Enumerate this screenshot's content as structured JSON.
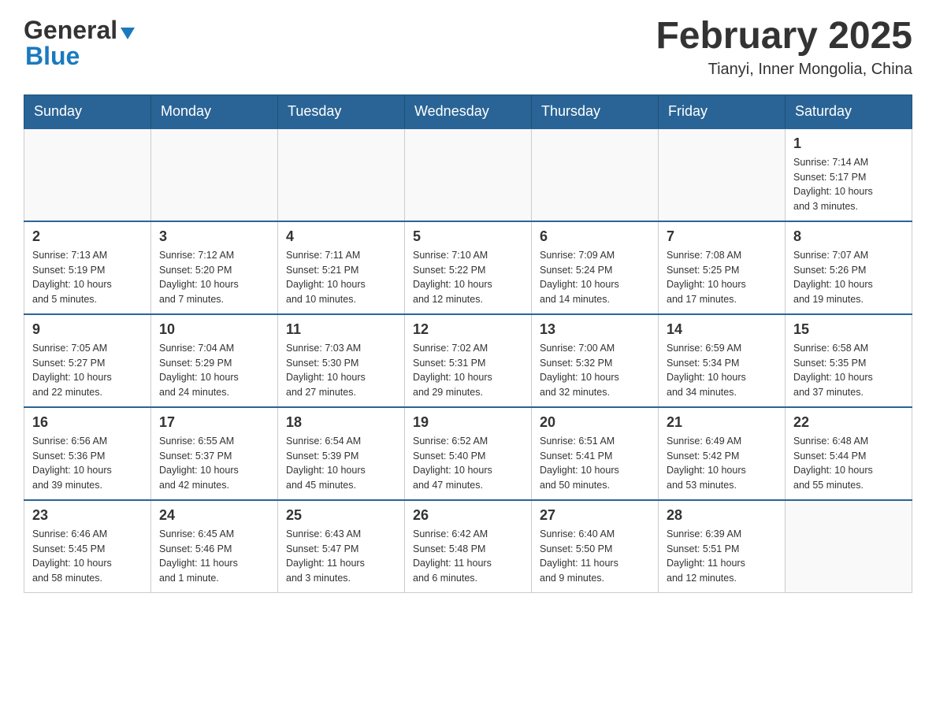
{
  "header": {
    "logo_general": "General",
    "logo_blue": "Blue",
    "month_title": "February 2025",
    "location": "Tianyi, Inner Mongolia, China"
  },
  "days_of_week": [
    "Sunday",
    "Monday",
    "Tuesday",
    "Wednesday",
    "Thursday",
    "Friday",
    "Saturday"
  ],
  "weeks": [
    {
      "days": [
        {
          "date": "",
          "info": ""
        },
        {
          "date": "",
          "info": ""
        },
        {
          "date": "",
          "info": ""
        },
        {
          "date": "",
          "info": ""
        },
        {
          "date": "",
          "info": ""
        },
        {
          "date": "",
          "info": ""
        },
        {
          "date": "1",
          "info": "Sunrise: 7:14 AM\nSunset: 5:17 PM\nDaylight: 10 hours\nand 3 minutes."
        }
      ]
    },
    {
      "days": [
        {
          "date": "2",
          "info": "Sunrise: 7:13 AM\nSunset: 5:19 PM\nDaylight: 10 hours\nand 5 minutes."
        },
        {
          "date": "3",
          "info": "Sunrise: 7:12 AM\nSunset: 5:20 PM\nDaylight: 10 hours\nand 7 minutes."
        },
        {
          "date": "4",
          "info": "Sunrise: 7:11 AM\nSunset: 5:21 PM\nDaylight: 10 hours\nand 10 minutes."
        },
        {
          "date": "5",
          "info": "Sunrise: 7:10 AM\nSunset: 5:22 PM\nDaylight: 10 hours\nand 12 minutes."
        },
        {
          "date": "6",
          "info": "Sunrise: 7:09 AM\nSunset: 5:24 PM\nDaylight: 10 hours\nand 14 minutes."
        },
        {
          "date": "7",
          "info": "Sunrise: 7:08 AM\nSunset: 5:25 PM\nDaylight: 10 hours\nand 17 minutes."
        },
        {
          "date": "8",
          "info": "Sunrise: 7:07 AM\nSunset: 5:26 PM\nDaylight: 10 hours\nand 19 minutes."
        }
      ]
    },
    {
      "days": [
        {
          "date": "9",
          "info": "Sunrise: 7:05 AM\nSunset: 5:27 PM\nDaylight: 10 hours\nand 22 minutes."
        },
        {
          "date": "10",
          "info": "Sunrise: 7:04 AM\nSunset: 5:29 PM\nDaylight: 10 hours\nand 24 minutes."
        },
        {
          "date": "11",
          "info": "Sunrise: 7:03 AM\nSunset: 5:30 PM\nDaylight: 10 hours\nand 27 minutes."
        },
        {
          "date": "12",
          "info": "Sunrise: 7:02 AM\nSunset: 5:31 PM\nDaylight: 10 hours\nand 29 minutes."
        },
        {
          "date": "13",
          "info": "Sunrise: 7:00 AM\nSunset: 5:32 PM\nDaylight: 10 hours\nand 32 minutes."
        },
        {
          "date": "14",
          "info": "Sunrise: 6:59 AM\nSunset: 5:34 PM\nDaylight: 10 hours\nand 34 minutes."
        },
        {
          "date": "15",
          "info": "Sunrise: 6:58 AM\nSunset: 5:35 PM\nDaylight: 10 hours\nand 37 minutes."
        }
      ]
    },
    {
      "days": [
        {
          "date": "16",
          "info": "Sunrise: 6:56 AM\nSunset: 5:36 PM\nDaylight: 10 hours\nand 39 minutes."
        },
        {
          "date": "17",
          "info": "Sunrise: 6:55 AM\nSunset: 5:37 PM\nDaylight: 10 hours\nand 42 minutes."
        },
        {
          "date": "18",
          "info": "Sunrise: 6:54 AM\nSunset: 5:39 PM\nDaylight: 10 hours\nand 45 minutes."
        },
        {
          "date": "19",
          "info": "Sunrise: 6:52 AM\nSunset: 5:40 PM\nDaylight: 10 hours\nand 47 minutes."
        },
        {
          "date": "20",
          "info": "Sunrise: 6:51 AM\nSunset: 5:41 PM\nDaylight: 10 hours\nand 50 minutes."
        },
        {
          "date": "21",
          "info": "Sunrise: 6:49 AM\nSunset: 5:42 PM\nDaylight: 10 hours\nand 53 minutes."
        },
        {
          "date": "22",
          "info": "Sunrise: 6:48 AM\nSunset: 5:44 PM\nDaylight: 10 hours\nand 55 minutes."
        }
      ]
    },
    {
      "days": [
        {
          "date": "23",
          "info": "Sunrise: 6:46 AM\nSunset: 5:45 PM\nDaylight: 10 hours\nand 58 minutes."
        },
        {
          "date": "24",
          "info": "Sunrise: 6:45 AM\nSunset: 5:46 PM\nDaylight: 11 hours\nand 1 minute."
        },
        {
          "date": "25",
          "info": "Sunrise: 6:43 AM\nSunset: 5:47 PM\nDaylight: 11 hours\nand 3 minutes."
        },
        {
          "date": "26",
          "info": "Sunrise: 6:42 AM\nSunset: 5:48 PM\nDaylight: 11 hours\nand 6 minutes."
        },
        {
          "date": "27",
          "info": "Sunrise: 6:40 AM\nSunset: 5:50 PM\nDaylight: 11 hours\nand 9 minutes."
        },
        {
          "date": "28",
          "info": "Sunrise: 6:39 AM\nSunset: 5:51 PM\nDaylight: 11 hours\nand 12 minutes."
        },
        {
          "date": "",
          "info": ""
        }
      ]
    }
  ]
}
